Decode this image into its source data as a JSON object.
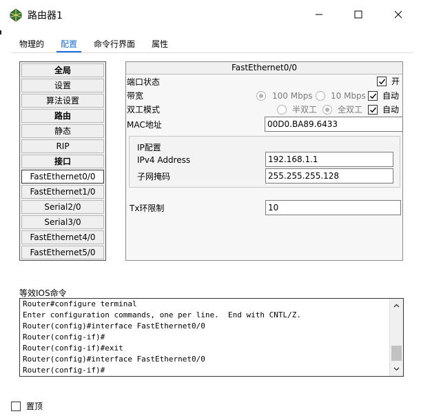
{
  "window": {
    "title": "路由器1",
    "controls": {
      "minimize": "minimize-icon",
      "maximize": "maximize-icon",
      "close": "close-icon"
    }
  },
  "tabs": [
    {
      "label": "物理的"
    },
    {
      "label": "配置",
      "active": true
    },
    {
      "label": "命令行界面"
    },
    {
      "label": "属性"
    }
  ],
  "sidebar": {
    "items": [
      {
        "label": "全局",
        "header": true
      },
      {
        "label": "设置"
      },
      {
        "label": "算法设置"
      },
      {
        "label": "路由",
        "header": true
      },
      {
        "label": "静态"
      },
      {
        "label": "RIP"
      },
      {
        "label": "接口",
        "header": true
      },
      {
        "label": "FastEthernet0/0",
        "selected": true
      },
      {
        "label": "FastEthernet1/0"
      },
      {
        "label": "Serial2/0"
      },
      {
        "label": "Serial3/0"
      },
      {
        "label": "FastEthernet4/0"
      },
      {
        "label": "FastEthernet5/0"
      }
    ]
  },
  "config": {
    "header": "FastEthernet0/0",
    "port_status": {
      "label": "端口状态",
      "checkbox_label": "开",
      "checked": true
    },
    "bandwidth": {
      "label": "带宽",
      "opt1": "100 Mbps",
      "opt2": "10 Mbps",
      "auto_label": "自动",
      "auto_checked": true
    },
    "duplex": {
      "label": "双工模式",
      "opt1": "半双工",
      "opt2": "全双工",
      "auto_label": "自动",
      "auto_checked": true
    },
    "mac": {
      "label": "MAC地址",
      "value": "00D0.BA89.6433"
    },
    "ip_config": {
      "label": "IP配置",
      "ipv4_label": "IPv4 Address",
      "ipv4_value": "192.168.1.1",
      "mask_label": "子网掩码",
      "mask_value": "255.255.255.128"
    },
    "tx": {
      "label": "Tx环限制",
      "value": "10"
    }
  },
  "ios": {
    "label": "等效IOS命令",
    "lines": [
      "Router#configure terminal",
      "Enter configuration commands, one per line.  End with CNTL/Z.",
      "Router(config)#interface FastEthernet0/0",
      "Router(config-if)#",
      "Router(config-if)#exit",
      "Router(config)#interface FastEthernet0/0",
      "Router(config-if)#"
    ]
  },
  "footer": {
    "pin_label": "置顶",
    "pin_checked": false
  },
  "colors": {
    "accent": "#1a6fd8"
  }
}
